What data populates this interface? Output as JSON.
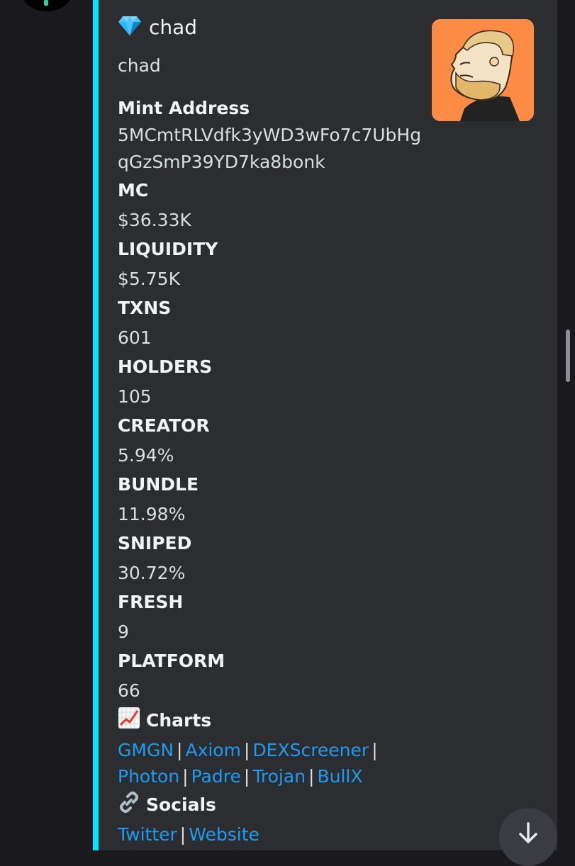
{
  "embed": {
    "accent_color": "#00e5ff",
    "author_icon": "gem-icon",
    "author_name": "chad",
    "description": "chad"
  },
  "fields": [
    {
      "name": "Mint Address",
      "value_lines": [
        "5MCmtRLVdfk3yWD3wFo7c7UbHg",
        "qGzSmP39YD7ka8bonk"
      ]
    },
    {
      "name": "MC",
      "value": "$36.33K"
    },
    {
      "name": "LIQUIDITY",
      "value": "$5.75K"
    },
    {
      "name": "TXNS",
      "value": "601"
    },
    {
      "name": "HOLDERS",
      "value": "105"
    },
    {
      "name": "CREATOR",
      "value": "5.94%"
    },
    {
      "name": "BUNDLE",
      "value": "11.98%"
    },
    {
      "name": "SNIPED",
      "value": "30.72%"
    },
    {
      "name": "FRESH",
      "value": "9"
    },
    {
      "name": "PLATFORM",
      "value": "66"
    }
  ],
  "charts": {
    "icon": "chart-increasing-icon",
    "title": "Charts",
    "links": [
      "GMGN",
      "Axiom",
      "DEXScreener",
      "Photon",
      "Padre",
      "Trojan",
      "BullX"
    ],
    "separator": "|"
  },
  "socials": {
    "icon": "link-icon",
    "title": "Socials",
    "links": [
      "Twitter",
      "Website"
    ]
  },
  "colors": {
    "link": "#1e9bf0",
    "thumbnail_bg": "#fd8b45",
    "embed_bg": "#2b2d31"
  },
  "jump_button_icon": "arrow-down-icon"
}
